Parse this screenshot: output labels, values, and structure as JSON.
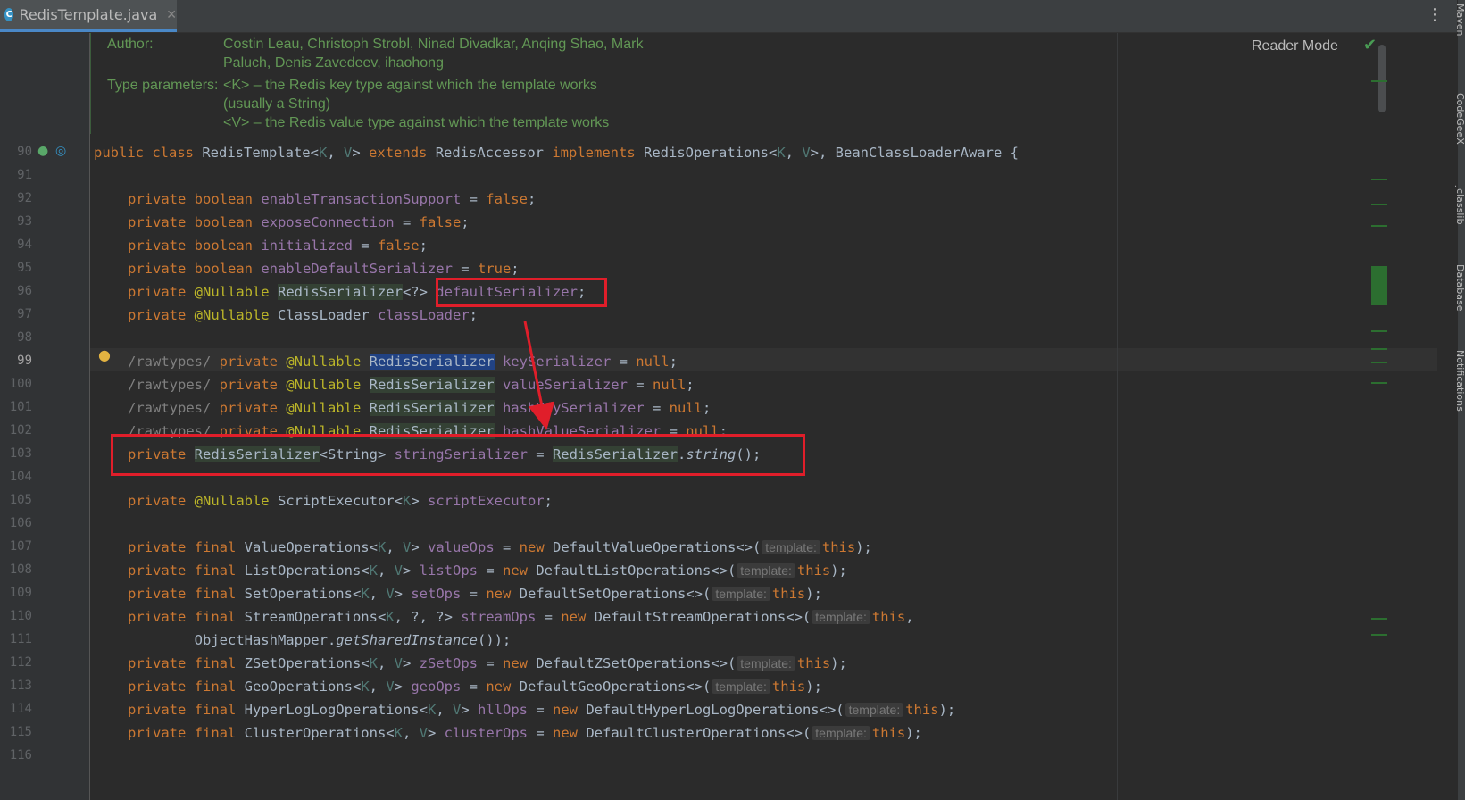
{
  "tab": {
    "title": "RedisTemplate.java",
    "icon": "C",
    "close": "✕"
  },
  "toolbar": {
    "more": "⋮"
  },
  "reader_mode": "Reader Mode",
  "doc": {
    "author_label": "Author:",
    "author_line1": "Costin Leau, Christoph Strobl, Ninad Divadkar, Anqing Shao, Mark",
    "author_line2": "Paluch, Denis Zavedeev, ihaohong",
    "type_label": "Type parameters:",
    "type_line1": "<K> – the Redis key type against which the template works",
    "type_line2": "(usually a String)",
    "type_line3": "<V> – the Redis value type against which the template works"
  },
  "lines": [
    "90",
    "91",
    "92",
    "93",
    "94",
    "95",
    "96",
    "97",
    "98",
    "99",
    "100",
    "101",
    "102",
    "103",
    "104",
    "105",
    "106",
    "107",
    "108",
    "109",
    "110",
    "111",
    "112",
    "113",
    "114",
    "115",
    "116"
  ],
  "hint_label": "template:",
  "right_bar": [
    "Maven",
    "CodeGeeX",
    "jclasslib",
    "Database",
    "Notifications"
  ]
}
